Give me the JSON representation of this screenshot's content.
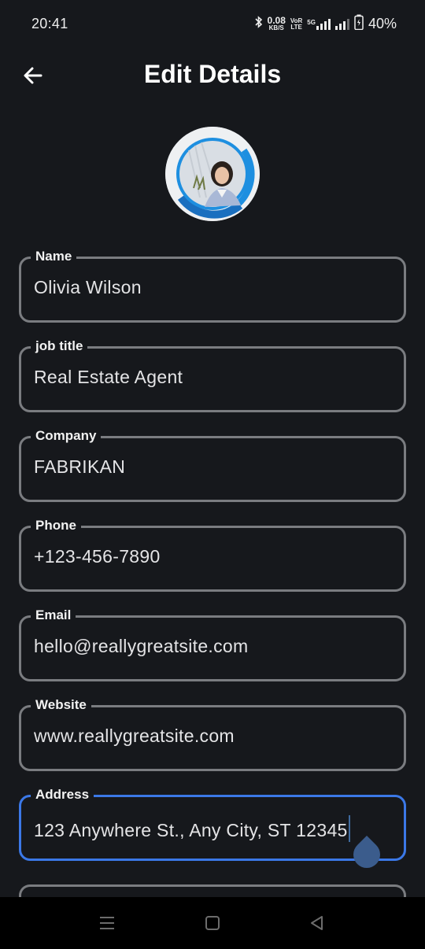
{
  "status_bar": {
    "time": "20:41",
    "net_speed_value": "0.08",
    "net_speed_unit": "KB/S",
    "volte_top": "VoR",
    "volte_bottom": "LTE",
    "network_type": "5G",
    "battery_percent": "40%"
  },
  "header": {
    "title": "Edit Details",
    "back_icon": "arrow-left-icon"
  },
  "profile": {
    "avatar_icon": "profile-photo",
    "ring_color": "#1e8fe0"
  },
  "fields": [
    {
      "label": "Name",
      "value": "Olivia Wilson"
    },
    {
      "label": "job title",
      "value": "Real Estate Agent"
    },
    {
      "label": "Company",
      "value": "FABRIKAN"
    },
    {
      "label": "Phone",
      "value": "+123-456-7890"
    },
    {
      "label": "Email",
      "value": "hello@reallygreatsite.com"
    },
    {
      "label": "Website",
      "value": "www.reallygreatsite.com"
    },
    {
      "label": "Address",
      "value": "123 Anywhere St., Any City, ST 12345"
    }
  ],
  "colors": {
    "background": "#16181c",
    "field_border": "#7a7c80",
    "focus_border": "#3b78e7",
    "caret": "#3b5c8c"
  },
  "nav_bar": {
    "recents_icon": "menu-lines-icon",
    "home_icon": "square-icon",
    "back_icon": "triangle-back-icon"
  }
}
